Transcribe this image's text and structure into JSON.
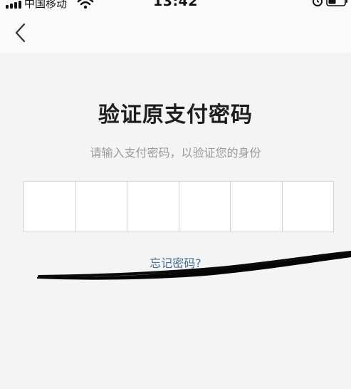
{
  "status_bar": {
    "carrier": "中国移动",
    "time": "13:42",
    "icons": [
      "signal-icon",
      "wifi-icon",
      "alarm-icon",
      "battery-icon"
    ]
  },
  "nav": {
    "back_icon": "chevron-left-icon"
  },
  "main": {
    "title": "验证原支付密码",
    "subtitle": "请输入支付密码，以验证您的身份",
    "pin_length": 6,
    "forgot_link": "忘记密码?"
  },
  "colors": {
    "background": "#f4f4f4",
    "link": "#4a6e96",
    "subtitle": "#9a9a9a",
    "scribble": "#000000"
  }
}
